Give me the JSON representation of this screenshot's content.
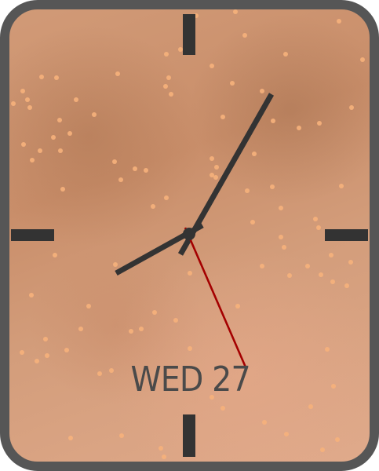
{
  "watch_face": {
    "date": {
      "weekday": "WED",
      "day": "27",
      "display": "WED 27"
    },
    "colors": {
      "case": "#565656",
      "dial_background": "#cf9672",
      "hands": "#333333",
      "second_hand": "#a40000",
      "markers": "#333333",
      "speckles": "#f7b27c",
      "date_text": "#4a4a4a"
    },
    "icons": {
      "hour_markers": "tick-marks",
      "speckles": "dot-pattern"
    }
  }
}
